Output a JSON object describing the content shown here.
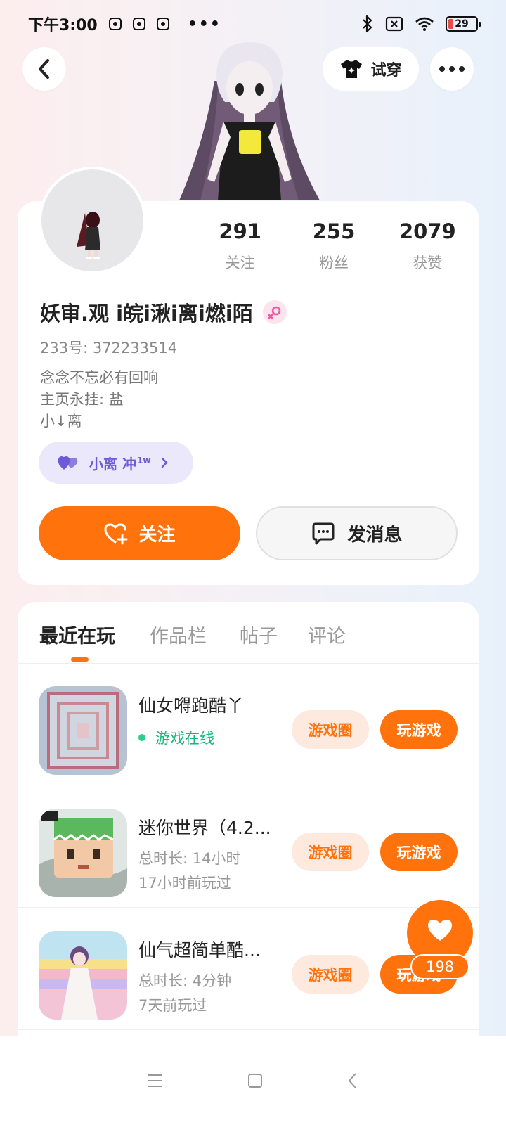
{
  "status_bar": {
    "time": "下午3:00",
    "dots": "•••",
    "battery": "29"
  },
  "header": {
    "try_on_label": "试穿"
  },
  "stats": [
    {
      "value": "291",
      "label": "关注"
    },
    {
      "value": "255",
      "label": "粉丝"
    },
    {
      "value": "2079",
      "label": "获赞"
    }
  ],
  "profile": {
    "nickname": "妖审.观 i皖i湫i离i燃i陌",
    "uid": "233号: 372233514",
    "bio": [
      "念念不忘必有回响",
      "主页永挂: 盐",
      "小↓离"
    ]
  },
  "fan_badge": {
    "label": "小离 冲",
    "sup": "1w"
  },
  "actions": {
    "follow_label": "关注",
    "message_label": "发消息"
  },
  "tabs": [
    "最近在玩",
    "作品栏",
    "帖子",
    "评论"
  ],
  "games": [
    {
      "title": "仙女嘚跑酷丫",
      "line1": "游戏在线",
      "line2": "",
      "circle_label": "游戏圈",
      "play_label": "玩游戏"
    },
    {
      "title": "迷你世界（4.2...",
      "line1": "总时长: 14小时",
      "line2": "17小时前玩过",
      "circle_label": "游戏圈",
      "play_label": "玩游戏"
    },
    {
      "title": "仙气超简单酷...",
      "line1": "总时长: 4分钟",
      "line2": "7天前玩过",
      "circle_label": "游戏圈",
      "play_label": "玩游戏"
    }
  ],
  "like_fab": {
    "count": "198"
  },
  "colors": {
    "accent": "#ff720c",
    "online": "#19b57a",
    "badge": "#6b5bd6"
  }
}
